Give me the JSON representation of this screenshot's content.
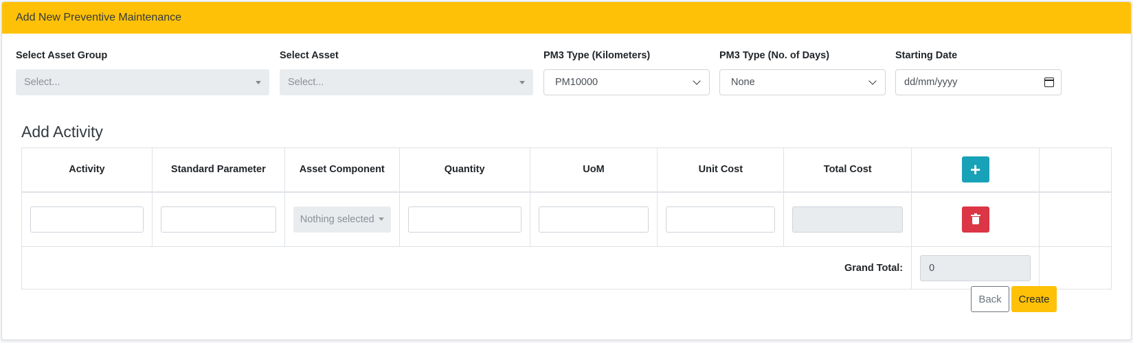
{
  "header": {
    "title": "Add New Preventive Maintenance"
  },
  "form": {
    "asset_group": {
      "label": "Select Asset Group",
      "placeholder": "Select..."
    },
    "asset": {
      "label": "Select Asset",
      "placeholder": "Select..."
    },
    "pm3_km": {
      "label": "PM3 Type (Kilometers)",
      "value": "PM10000"
    },
    "pm3_days": {
      "label": "PM3 Type (No. of Days)",
      "value": "None"
    },
    "start_date": {
      "label": "Starting Date",
      "placeholder": "dd/mm/yyyy"
    }
  },
  "activity": {
    "title": "Add Activity",
    "columns": [
      "Activity",
      "Standard Parameter",
      "Asset Component",
      "Quantity",
      "UoM",
      "Unit Cost",
      "Total Cost"
    ],
    "row": {
      "asset_component_placeholder": "Nothing selected"
    },
    "add_button_icon": "plus-icon",
    "delete_button_icon": "trash-icon",
    "grand_total_label": "Grand Total:",
    "grand_total_value": "0"
  },
  "actions": {
    "back": "Back",
    "create": "Create"
  },
  "colors": {
    "header": "#ffc107",
    "add": "#17a2b8",
    "delete": "#dc3545",
    "create": "#ffc107"
  }
}
